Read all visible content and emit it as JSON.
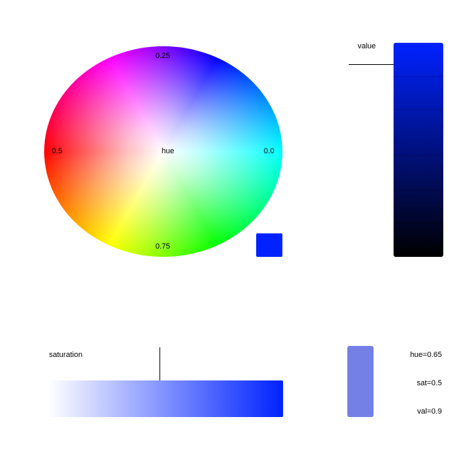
{
  "wheel": {
    "center_label": "hue",
    "label_0": "0.0",
    "label_25": "0.25",
    "label_5": "0.5",
    "label_75": "0.75"
  },
  "value_slider": {
    "label": "value",
    "level": 0.9,
    "color_top": "#0022ff",
    "color_bottom": "#000000"
  },
  "saturation_slider": {
    "label": "saturation",
    "level": 0.5,
    "color_low": "#ffffff",
    "color_high": "#0022ff"
  },
  "current_color": "#0022ff",
  "preview_color": "#7480e6",
  "readouts": {
    "hue": "hue=0.65",
    "sat": "sat=0.5",
    "val": "val=0.9"
  }
}
